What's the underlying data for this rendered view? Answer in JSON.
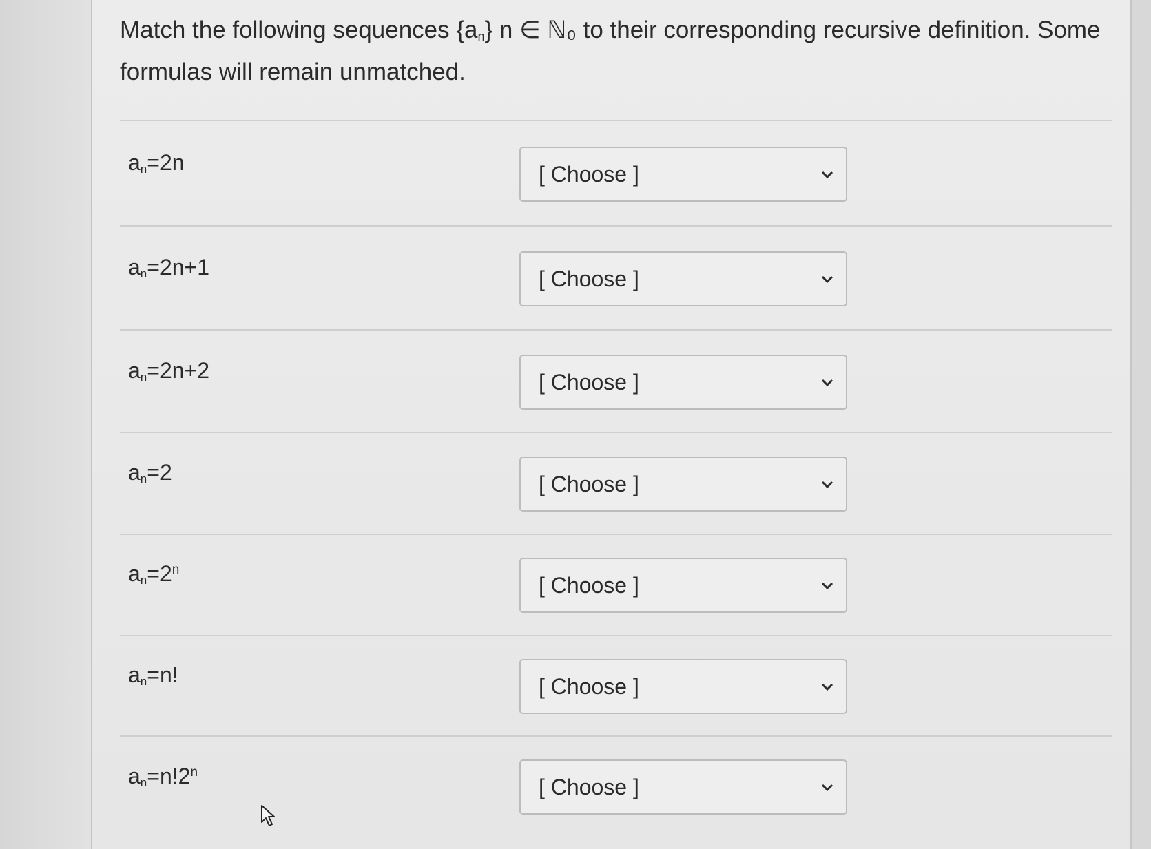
{
  "question": {
    "prefix": "Match the following sequences {a",
    "sub": "n",
    "suffix": "} n ∈ ℕ₀ to their corresponding recursive definition. Some formulas will remain unmatched."
  },
  "rows": [
    {
      "base": "a",
      "sub": "n",
      "expr": "=2n",
      "sup": "",
      "tail": "",
      "select": "[ Choose ]"
    },
    {
      "base": "a",
      "sub": "n",
      "expr": "=2n+1",
      "sup": "",
      "tail": "",
      "select": "[ Choose ]"
    },
    {
      "base": "a",
      "sub": "n",
      "expr": "=2n+2",
      "sup": "",
      "tail": "",
      "select": "[ Choose ]"
    },
    {
      "base": "a",
      "sub": "n",
      "expr": "=2",
      "sup": "",
      "tail": "",
      "select": "[ Choose ]"
    },
    {
      "base": "a",
      "sub": "n",
      "expr": "=2",
      "sup": "n",
      "tail": "",
      "select": "[ Choose ]"
    },
    {
      "base": "a",
      "sub": "n",
      "expr": "=n!",
      "sup": "",
      "tail": "",
      "select": "[ Choose ]"
    },
    {
      "base": "a",
      "sub": "n",
      "expr": "=n!2",
      "sup": "n",
      "tail": "",
      "select": "[ Choose ]"
    }
  ],
  "icons": {
    "dropdown": "chevron-down-icon",
    "cursor": "mouse-pointer-icon"
  },
  "colors": {
    "text": "#2b2b2b",
    "border": "#bcbcbc",
    "background": "#ececec"
  }
}
